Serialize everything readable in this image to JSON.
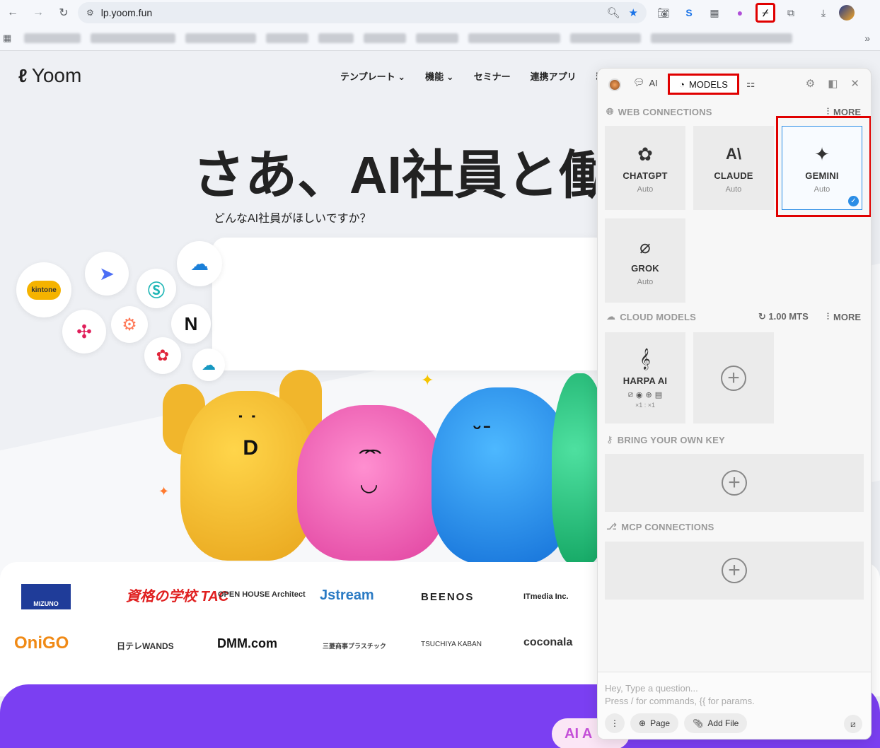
{
  "browser": {
    "url": "lp.yoom.fun",
    "back_icon": "←",
    "forward_icon": "→",
    "reload_icon": "↻"
  },
  "site": {
    "logo": "Yoom",
    "nav": [
      "テンプレート ⌄",
      "機能 ⌄",
      "セミナー",
      "連携アプリ",
      "料"
    ],
    "hero_title": "さあ、AI社員と働こう",
    "hero_sub": "どんなAI社員がほしいですか？",
    "kintone": "kintone",
    "ai_badge": "AI A",
    "logos_row1": [
      "MIZUNO",
      "資格の学校 TAC",
      "OPEN HOUSE Architect",
      "Jstream",
      "BEENOS",
      "ITmedia Inc."
    ],
    "logos_row2": [
      "OniGO",
      "日テレWANDS",
      "DMM.com",
      "三菱商事プラスチック",
      "TSUCHIYA KABAN",
      "coconala"
    ]
  },
  "panel": {
    "tab_ai": "AI",
    "tab_models": "MODELS",
    "web_connections": {
      "title": "WEB CONNECTIONS",
      "more": "MORE",
      "cards": [
        {
          "name": "CHATGPT",
          "sub": "Auto",
          "icon": "openai-icon"
        },
        {
          "name": "CLAUDE",
          "sub": "Auto",
          "icon": "anthropic-icon"
        },
        {
          "name": "GEMINI",
          "sub": "Auto",
          "icon": "gemini-icon",
          "selected": true
        },
        {
          "name": "GROK",
          "sub": "Auto",
          "icon": "grok-icon"
        }
      ]
    },
    "cloud_models": {
      "title": "CLOUD MODELS",
      "mts": "1.00 MTS",
      "more": "MORE",
      "harpa": {
        "name": "HARPA AI",
        "multipliers": "×1 : ×1"
      }
    },
    "byok": {
      "title": "BRING YOUR OWN KEY"
    },
    "mcp": {
      "title": "MCP CONNECTIONS"
    },
    "composer": {
      "placeholder_line1": "Hey, Type a question...",
      "placeholder_line2": "Press / for commands, {{ for params.",
      "page_btn": "Page",
      "add_file_btn": "Add File"
    }
  }
}
